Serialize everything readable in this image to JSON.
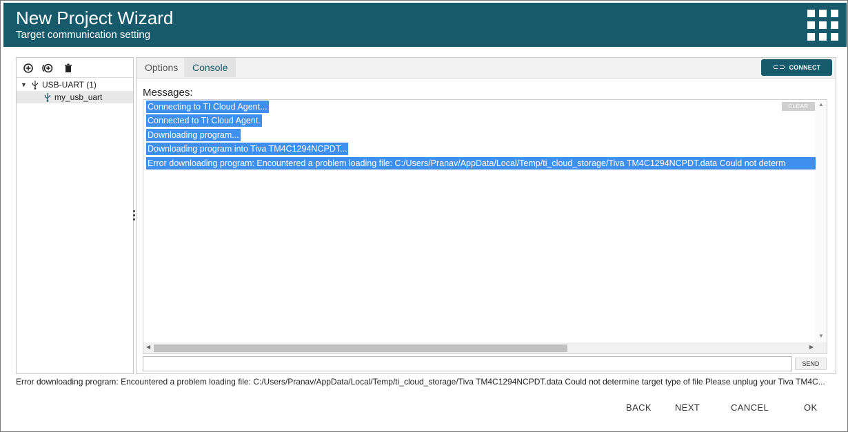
{
  "header": {
    "title": "New Project Wizard",
    "subtitle": "Target communication setting",
    "menu_icon": "apps-grid-icon"
  },
  "left_toolbar": {
    "icons": [
      "add-circle-icon",
      "add-connection-icon",
      "trash-icon"
    ]
  },
  "tree": {
    "root": {
      "label": "USB-UART (1)",
      "icon": "usb-icon",
      "expanded": true
    },
    "children": [
      {
        "label": "my_usb_uart",
        "icon": "usb-icon",
        "selected": true
      }
    ]
  },
  "tabs": [
    {
      "label": "Options",
      "active": false
    },
    {
      "label": "Console",
      "active": true
    }
  ],
  "connect_button": {
    "label": "CONNECT",
    "icon": "connect-icon"
  },
  "console": {
    "messages_label": "Messages:",
    "clear_label": "CLEAR",
    "lines": [
      "Connecting to TI Cloud Agent...",
      "Connected to TI Cloud Agent.",
      "Downloading program...",
      "Downloading program into Tiva TM4C1294NCPDT...",
      "Error downloading program: Encountered a problem loading file: C:/Users/Pranav/AppData/Local/Temp/ti_cloud_storage/Tiva TM4C1294NCPDT.data Could not determ"
    ],
    "send_input_value": "",
    "send_label": "SEND"
  },
  "status_text": "Error downloading program: Encountered a problem loading file: C:/Users/Pranav/AppData/Local/Temp/ti_cloud_storage/Tiva TM4C1294NCPDT.data Could not determine target type of file Please unplug your Tiva TM4C...",
  "footer": {
    "back_label": "BACK",
    "next_label": "NEXT",
    "cancel_label": "CANCEL",
    "ok_label": "OK"
  },
  "colors": {
    "header_bg": "#165a6b",
    "selection": "#3f8fef",
    "accent": "#165a6b"
  }
}
